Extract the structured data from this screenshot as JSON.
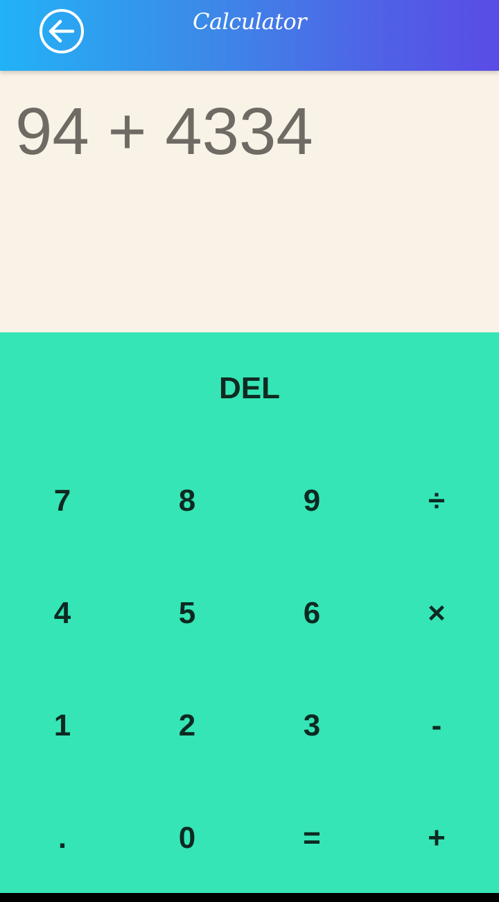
{
  "header": {
    "title": "Calculator",
    "back_icon": "arrow-left-circle-icon"
  },
  "display": {
    "expression": "94 + 4334"
  },
  "keypad": {
    "del_label": "DEL",
    "rows": [
      [
        "7",
        "8",
        "9",
        "÷"
      ],
      [
        "4",
        "5",
        "6",
        "×"
      ],
      [
        "1",
        "2",
        "3",
        "-"
      ],
      [
        ".",
        "0",
        "=",
        "+"
      ]
    ]
  },
  "colors": {
    "header_gradient_start": "#22b2f6",
    "header_gradient_end": "#5a4be6",
    "display_bg": "#f9f2e6",
    "display_text": "#6f6b64",
    "keypad_bg": "#36e5b5",
    "key_text": "#0d2a22"
  }
}
